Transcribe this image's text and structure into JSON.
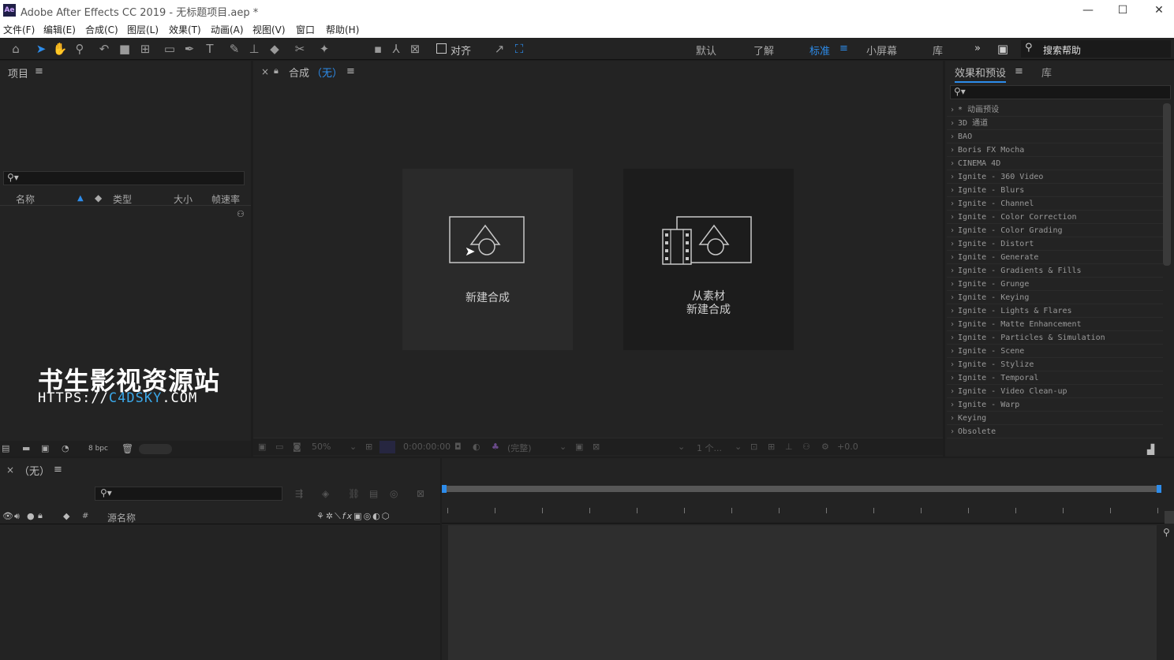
{
  "window": {
    "app_badge": "Ae",
    "title": "Adobe After Effects CC 2019 - 无标题项目.aep *",
    "min": "—",
    "max": "☐",
    "close": "✕"
  },
  "menu": [
    "文件(F)",
    "编辑(E)",
    "合成(C)",
    "图层(L)",
    "效果(T)",
    "动画(A)",
    "视图(V)",
    "窗口",
    "帮助(H)"
  ],
  "toolbar": {
    "align_label": "对齐",
    "workspaces": [
      "默认",
      "了解",
      "标准",
      "小屏幕",
      "库"
    ],
    "active_workspace": "标准",
    "more": "»",
    "help_search_placeholder": "搜索帮助"
  },
  "project_panel": {
    "title": "项目",
    "menu": "≡",
    "columns": [
      "名称",
      "类型",
      "大小",
      "帧速率"
    ],
    "bpc": "8 bpc"
  },
  "comp_panel": {
    "close": "×",
    "title": "合成",
    "comp_name": "（无）",
    "menu": "≡",
    "card_new": "新建合成",
    "card_from_footage_line1": "从素材",
    "card_from_footage_line2": "新建合成",
    "zoom": "50%",
    "timecode": "0:00:00:00",
    "resolution": "(完整)",
    "views": "1 个...",
    "exposure": "+0.0"
  },
  "effects_panel": {
    "title": "效果和预设",
    "menu": "≡",
    "library_tab": "库",
    "items": [
      "* 动画预设",
      "3D 通道",
      "BAO",
      "Boris FX Mocha",
      "CINEMA 4D",
      "Ignite - 360 Video",
      "Ignite - Blurs",
      "Ignite - Channel",
      "Ignite - Color Correction",
      "Ignite - Color Grading",
      "Ignite - Distort",
      "Ignite - Generate",
      "Ignite - Gradients & Fills",
      "Ignite - Grunge",
      "Ignite - Keying",
      "Ignite - Lights & Flares",
      "Ignite - Matte Enhancement",
      "Ignite - Particles & Simulation",
      "Ignite - Scene",
      "Ignite - Stylize",
      "Ignite - Temporal",
      "Ignite - Video Clean-up",
      "Ignite - Warp",
      "Keying",
      "Obsolete"
    ]
  },
  "timeline": {
    "close": "×",
    "comp_name": "（无）",
    "menu": "≡",
    "col_num": "#",
    "col_source_name": "源名称"
  },
  "watermark": {
    "cn": "书生影视资源站",
    "url_prefix": "HTTPS://",
    "url_brand": "C4DSKY",
    "url_suffix": ".COM"
  },
  "colors": {
    "accent": "#2d8ceb",
    "panel_bg": "#232323",
    "app_bg": "#1d1d1d"
  }
}
